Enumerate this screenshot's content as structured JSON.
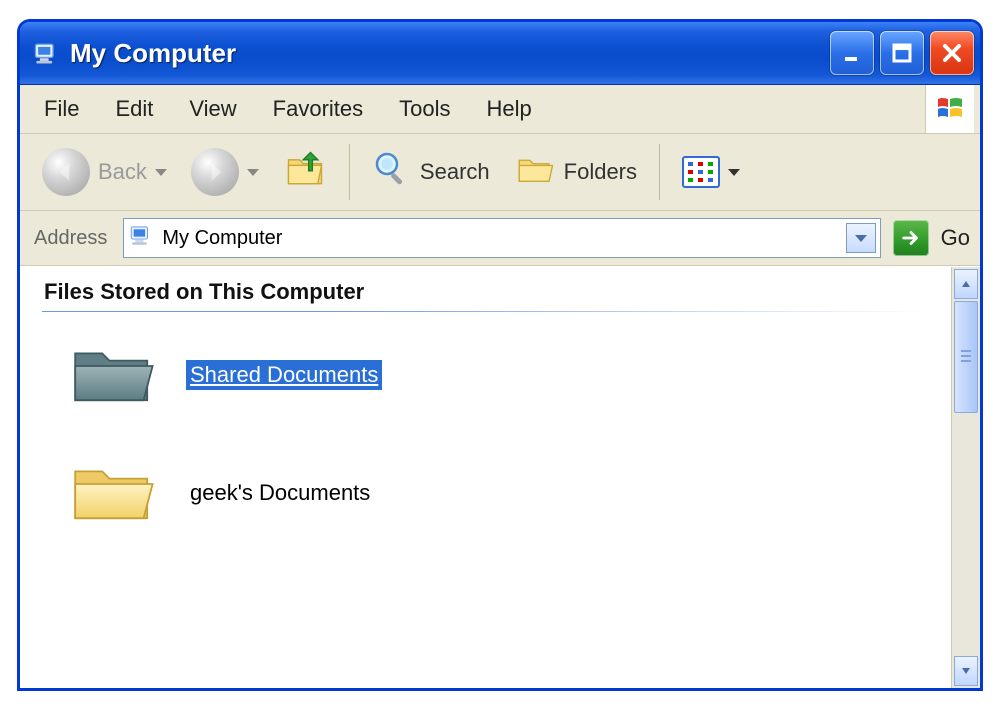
{
  "title": "My Computer",
  "menu": {
    "file": "File",
    "edit": "Edit",
    "view": "View",
    "favorites": "Favorites",
    "tools": "Tools",
    "help": "Help"
  },
  "toolbar": {
    "back": "Back",
    "search": "Search",
    "folders": "Folders"
  },
  "address": {
    "label": "Address",
    "value": "My Computer",
    "go": "Go"
  },
  "content": {
    "section_header": "Files Stored on This Computer",
    "items": [
      {
        "label": "Shared Documents",
        "selected": true,
        "icon": "folder-dark"
      },
      {
        "label": "geek's Documents",
        "selected": false,
        "icon": "folder"
      }
    ]
  }
}
